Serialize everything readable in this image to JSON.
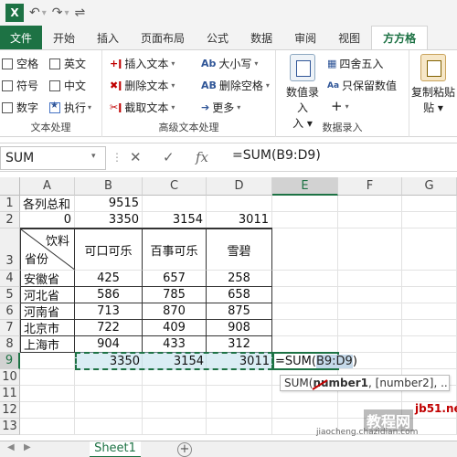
{
  "qat": {
    "undo": "↶",
    "redo": "↷",
    "pin": "⇌"
  },
  "tabs": [
    {
      "label": "文件"
    },
    {
      "label": "开始"
    },
    {
      "label": "插入"
    },
    {
      "label": "页面布局"
    },
    {
      "label": "公式"
    },
    {
      "label": "数据"
    },
    {
      "label": "审阅"
    },
    {
      "label": "视图"
    },
    {
      "label": "方方格"
    }
  ],
  "ribbon": {
    "text_group": {
      "label": "文本处理",
      "checks": [
        "空格",
        "英文",
        "符号",
        "中文",
        "数字",
        "执行"
      ]
    },
    "advanced_group": {
      "label": "高级文本处理",
      "commands": [
        "插入文本",
        "删除文本",
        "截取文本",
        "大小写",
        "删除空格",
        "更多"
      ]
    },
    "entry_group": {
      "label": "数据录入",
      "big_button": "数值录入",
      "commands": [
        "四舍五入",
        "只保留数值"
      ],
      "plus": "+"
    },
    "paste_group": {
      "label": "复制粘贴"
    }
  },
  "formula_bar": {
    "name_box": "SUM",
    "cancel": "✕",
    "confirm": "✓",
    "fx": "fx",
    "formula": "=SUM(B9:D9)"
  },
  "columns": [
    "A",
    "B",
    "C",
    "D",
    "E",
    "F",
    "G"
  ],
  "rows": [
    "1",
    "2",
    "3",
    "4",
    "5",
    "6",
    "7",
    "8",
    "9",
    "10",
    "11",
    "12",
    "13"
  ],
  "table": {
    "r1": {
      "a": "各列总和",
      "b": "9515"
    },
    "r2": {
      "a": "0",
      "b": "3350",
      "c": "3154",
      "d": "3011"
    },
    "r3": {
      "diag_top": "饮料",
      "diag_bottom": "省份",
      "b": "可口可乐",
      "c": "百事可乐",
      "d": "雪碧"
    },
    "data": [
      {
        "a": "安徽省",
        "b": "425",
        "c": "657",
        "d": "258"
      },
      {
        "a": "河北省",
        "b": "586",
        "c": "785",
        "d": "658"
      },
      {
        "a": "河南省",
        "b": "713",
        "c": "870",
        "d": "875"
      },
      {
        "a": "北京市",
        "b": "722",
        "c": "409",
        "d": "908"
      },
      {
        "a": "上海市",
        "b": "904",
        "c": "433",
        "d": "312"
      }
    ],
    "r9": {
      "b": "3350",
      "c": "3154",
      "d": "3011",
      "e_prefix": "=SUM(",
      "e_ref": "B9:D9",
      "e_suffix": ")"
    }
  },
  "tooltip": {
    "fn": "SUM(",
    "arg1": "number1",
    "rest": ", [number2], ...)"
  },
  "sheet_tab": "Sheet1",
  "add_sheet": "+",
  "watermark": {
    "main": "教程网",
    "url": "jiaocheng.chazidian.com",
    "corner": "jb51.net"
  },
  "colors": {
    "excel_green": "#1d7244",
    "selection_blue": "#c5d9ea"
  }
}
